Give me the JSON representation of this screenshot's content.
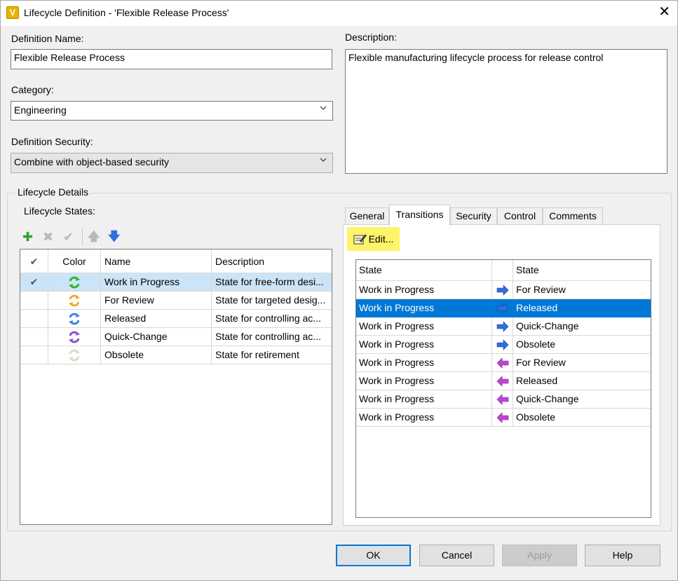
{
  "window": {
    "title": "Lifecycle Definition - 'Flexible Release Process'",
    "close_glyph": "✕",
    "app_glyph": "V"
  },
  "definition_name": {
    "label": "Definition Name:",
    "value": "Flexible Release Process"
  },
  "description": {
    "label": "Description:",
    "value": "Flexible manufacturing lifecycle process for release control"
  },
  "category": {
    "label": "Category:",
    "value": "Engineering"
  },
  "definition_security": {
    "label": "Definition Security:",
    "value": "Combine with object-based security"
  },
  "lifecycle_details": {
    "group_label": "Lifecycle Details",
    "states_label": "Lifecycle States:",
    "columns": {
      "check": "✔",
      "color": "Color",
      "name": "Name",
      "description": "Description"
    },
    "states": [
      {
        "checked": "✔",
        "name": "Work in Progress",
        "description": "State for free-form desi...",
        "color": "#2db52d"
      },
      {
        "checked": "",
        "name": "For Review",
        "description": "State for targeted desig...",
        "color": "#f0a830"
      },
      {
        "checked": "",
        "name": "Released",
        "description": "State for controlling ac...",
        "color": "#3a86e0"
      },
      {
        "checked": "",
        "name": "Quick-Change",
        "description": "State for controlling ac...",
        "color": "#8a4fd6"
      },
      {
        "checked": "",
        "name": "Obsolete",
        "description": "State for retirement",
        "color": "#d8dcc4"
      }
    ]
  },
  "tabs": [
    "General",
    "Transitions",
    "Security",
    "Control",
    "Comments"
  ],
  "active_tab": "Transitions",
  "transitions": {
    "edit_label": "Edit...",
    "columns": {
      "from": "State",
      "to": "State"
    },
    "rows": [
      {
        "from": "Work in Progress",
        "to": "For Review",
        "direction": "forward"
      },
      {
        "from": "Work in Progress",
        "to": "Released",
        "direction": "forward"
      },
      {
        "from": "Work in Progress",
        "to": "Quick-Change",
        "direction": "forward"
      },
      {
        "from": "Work in Progress",
        "to": "Obsolete",
        "direction": "forward"
      },
      {
        "from": "Work in Progress",
        "to": "For Review",
        "direction": "backward"
      },
      {
        "from": "Work in Progress",
        "to": "Released",
        "direction": "backward"
      },
      {
        "from": "Work in Progress",
        "to": "Quick-Change",
        "direction": "backward"
      },
      {
        "from": "Work in Progress",
        "to": "Obsolete",
        "direction": "backward"
      }
    ],
    "selected_index": 1
  },
  "buttons": {
    "ok": "OK",
    "cancel": "Cancel",
    "apply": "Apply",
    "help": "Help"
  },
  "colors": {
    "selection": "#0078d7",
    "row_highlight": "#cce4f7",
    "edit_highlight": "#fdf46a",
    "forward_arrow": "#2f6fe0",
    "backward_arrow": "#c043d8"
  }
}
